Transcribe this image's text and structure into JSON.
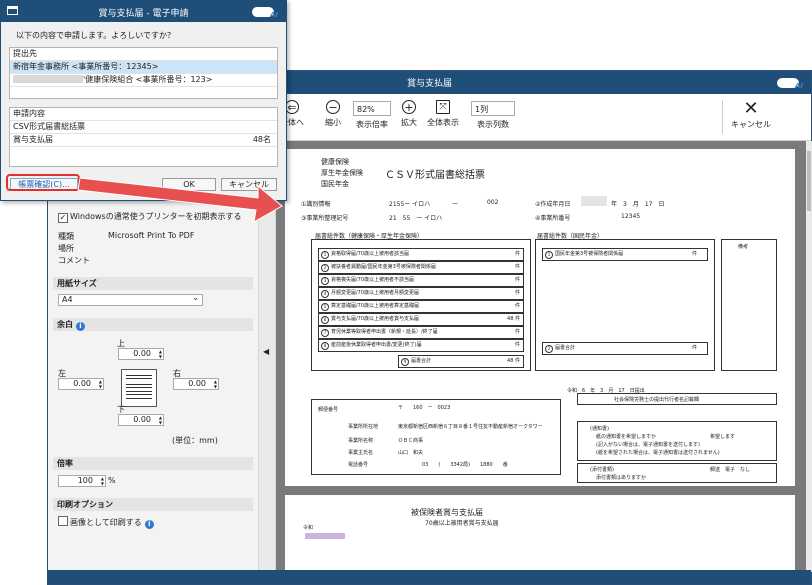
{
  "main": {
    "title": "賞与支払届",
    "toolbar": {
      "back": "全体へ",
      "zoom_out": "縮小",
      "zoom_value": "82%",
      "zoom_label": "表示倍率",
      "zoom_in": "拡大",
      "fit": "全体表示",
      "columns_value": "1列",
      "columns_label": "表示列数",
      "cancel": "キャンセル"
    },
    "panel": {
      "default_printer_check": "Windowsの通常使うプリンターを初期表示する",
      "type_label": "種類",
      "type_value": "Microsoft Print To PDF",
      "location_label": "場所",
      "comment_label": "コメント",
      "paper_size_title": "用紙サイズ",
      "paper_size_value": "A4",
      "margin_title": "余白",
      "margin_top_label": "上",
      "margin_left_label": "左",
      "margin_right_label": "右",
      "margin_bottom_label": "下",
      "margin_top": "0.00",
      "margin_left": "0.00",
      "margin_right": "0.00",
      "margin_bottom": "0.00",
      "unit": "(単位：mm)",
      "scale_title": "倍率",
      "scale_value": "100",
      "scale_unit": "%",
      "print_option_title": "印刷オプション",
      "print_as_image": "画像として印刷する"
    },
    "form": {
      "hdr_1": "健康保険",
      "hdr_2": "厚生年金保険",
      "hdr_3": "国民年金",
      "hdr_title": "ＣＳＶ形式届書総括票",
      "f1_label": "①識別情報",
      "f1_value": "2155ー イロハ",
      "f1_dash": "ー",
      "f1_code": "002",
      "f2_label": "②作成年月日",
      "f2_value": "年　3　月　17　日",
      "f3_label": "③事業所整理記号",
      "f3_value": "21　55　ー イロハ",
      "f4_label": "④事業所番号",
      "f4_value": "12345",
      "count_health_title": "届書総件数（健康保険・厚生年金保険）",
      "count_national_title": "届書総件数（国民年金）",
      "rows": [
        {
          "n": "1",
          "label": "資格取得届/70歳以上被用者該当届",
          "count": "件"
        },
        {
          "n": "2",
          "label": "被扶養者異動届/国民年金第3号被保険者関係届",
          "count": "件"
        },
        {
          "n": "3",
          "label": "資格喪失届/70歳以上被用者不該当届",
          "count": "件"
        },
        {
          "n": "4",
          "label": "月額変更届/70歳以上被用者月額変更届",
          "count": "件"
        },
        {
          "n": "5",
          "label": "算定基礎届/70歳以上被用者算定基礎届",
          "count": "件"
        },
        {
          "n": "6",
          "label": "賞与支払届/70歳以上被用者賞与支払届",
          "count": "48 件"
        },
        {
          "n": "7",
          "label": "育児休業等取得者申出書（新規・延長）/終了届",
          "count": "件"
        },
        {
          "n": "8",
          "label": "産前産後休業取得者申出書/変更(終了)届",
          "count": "件"
        }
      ],
      "total_label": "届書合計",
      "total_value": "48 件",
      "nat_row": "国民年金第3号被保険者関係届",
      "nat_count": "件",
      "nat_total": "届書合計",
      "nat_total_count": "件",
      "remarks": "備考",
      "submit_date": "令和　6　年　3　月　17　日提出",
      "postal_label": "郵便番号",
      "postal_value": "〒　　160　ー　0023",
      "address_label": "事業所所在地",
      "address_value": "東京都新宿区西新宿６丁目８番１号住友不動産新宿オークタワー",
      "name_label": "事業所名称",
      "name_value": "ＯＢＣ商事",
      "owner_label": "事業主氏名",
      "owner_value": "山口　和夫",
      "phone_label": "電話番号",
      "phone_value": "03　　(　　3342局)　　1880　　番",
      "agent": "社会保険労務士の提出代行者名記載欄",
      "notice_title": "(通知書)",
      "notice_1": "紙の通知書を希望しますか",
      "notice_hope": "希望します",
      "notice_2": "(記入がない場合は、電子通知書を送付します)",
      "notice_3": "(紙を希望された場合は、電子通知書は送付されません)",
      "attach_title": "(添付書類)",
      "attach_q": "添付書類はありますか",
      "attach_cols": "郵送　電子　なし",
      "page2_title": "被保険者賞与支払届",
      "page2_sub": "70歳以上被用者賞与支払届",
      "page2_era": "令和"
    }
  },
  "dialog": {
    "title": "賞与支払届 - 電子申請",
    "question": "以下の内容で申請します。よろしいですか？",
    "dest_header": "提出先",
    "dest_1": "新宿年金事務所 <事業所番号：12345>",
    "dest_2": "'健康保険組合 <事業所番号：123>",
    "content_header": "申請内容",
    "content_1": "CSV形式届書総括票",
    "content_2": "賞与支払届",
    "content_2_count": "48名",
    "form_confirm": "帳票確認(C)...",
    "ok": "OK",
    "cancel": "キャンセル"
  },
  "colors": {
    "titlebar": "#1f4e79",
    "callout": "#e03030",
    "selection": "#cce4f7"
  }
}
